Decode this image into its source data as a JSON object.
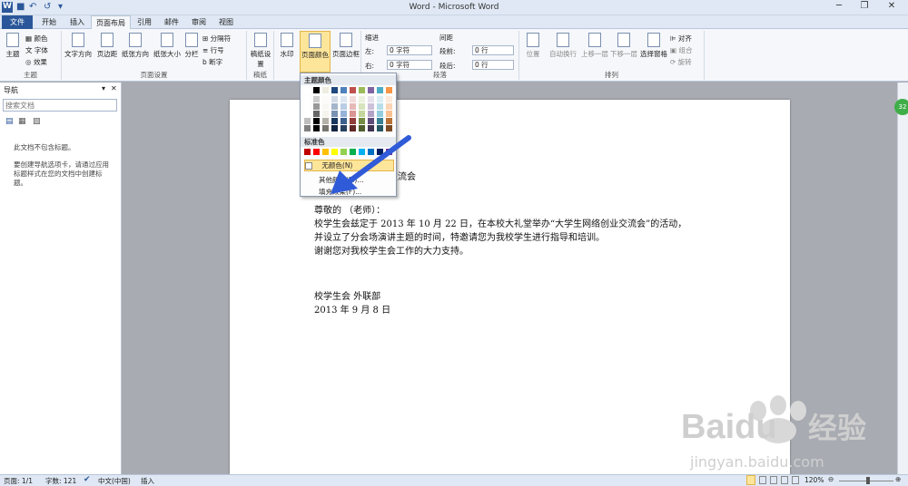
{
  "title_bar": {
    "title": "Word - Microsoft Word",
    "qa_undo": "↶",
    "qa_redo": "↺",
    "qa_more": "▾",
    "min": "─",
    "max": "❐",
    "close": "✕"
  },
  "tabs": [
    {
      "label": "文件"
    },
    {
      "label": "开始"
    },
    {
      "label": "插入"
    },
    {
      "label": "页面布局"
    },
    {
      "label": "引用"
    },
    {
      "label": "邮件"
    },
    {
      "label": "审阅"
    },
    {
      "label": "视图"
    }
  ],
  "ribbon": {
    "themes": {
      "group": "主题",
      "theme": "主题",
      "colors": "颜色",
      "fonts": "字体",
      "effects": "效果"
    },
    "page_setup": {
      "group": "页面设置",
      "text_direction": "文字方向",
      "margins": "页边距",
      "orientation": "纸张方向",
      "size": "纸张大小",
      "columns": "分栏",
      "breaks": "分隔符",
      "line_numbers": "行号",
      "hyphenation": "断字"
    },
    "draft": {
      "group": "稿纸",
      "label": "稿纸设置"
    },
    "page_bg": {
      "watermark": "水印",
      "page_color": "页面颜色",
      "page_borders": "页面边框"
    },
    "paragraph": {
      "group": "段落",
      "indent": "缩进",
      "spacing": "间距",
      "left": "左:",
      "right": "右:",
      "before": "段前:",
      "after": "段后:",
      "left_val": "0 字符",
      "right_val": "0 字符",
      "before_val": "0 行",
      "after_val": "0 行"
    },
    "arrange": {
      "group": "排列",
      "position": "位置",
      "wrap": "自动换行",
      "forward": "上移一层",
      "backward": "下移一层",
      "selection_pane": "选择窗格",
      "align": "对齐",
      "group_btn": "组合",
      "rotate": "旋转"
    }
  },
  "nav_pane": {
    "title": "导航",
    "search_placeholder": "搜索文档",
    "empty_title": "此文档不包含标题。",
    "hint": "要创建导航选项卡，请通过应用标题样式在您的文档中创建标题。"
  },
  "dropdown": {
    "theme_colors": "主题颜色",
    "standard_colors": "标准色",
    "no_color": "无颜色(N)",
    "more_colors": "其他颜色(M)...",
    "fill_effects": "填充效果(F)..."
  },
  "colors": {
    "theme_top": [
      "#ffffff",
      "#000000",
      "#eeece1",
      "#1f497d",
      "#4f81bd",
      "#c0504d",
      "#9bbb59",
      "#8064a2",
      "#4bacc6",
      "#f79646"
    ],
    "standard": [
      "#c00000",
      "#ff0000",
      "#ffc000",
      "#ffff00",
      "#92d050",
      "#00b050",
      "#00b0f0",
      "#0070c0",
      "#002060",
      "#7030a0"
    ]
  },
  "document": {
    "line1": "交流会",
    "greeting": "尊敬的           （老师）：",
    "p1": "校学生会兹定于 2013 年 10 月 22 日，在本校大礼堂举办“大学生网络创业交流会”的活动，",
    "p2": "并设立了分会场演讲主题的时间，特邀请您为我校学生进行指导和培训。",
    "p3": "谢谢您对我校学生会工作的大力支持。",
    "sign": "校学生会  外联部",
    "date": "2013 年 9 月 8 日"
  },
  "status": {
    "page": "页面: 1/1",
    "words": "字数: 121",
    "lang": "中文(中国)",
    "mode": "插入",
    "zoom": "120%"
  },
  "watermark": {
    "brand": "Baidu",
    "cn": "经验",
    "url": "jingyan.baidu.com"
  }
}
